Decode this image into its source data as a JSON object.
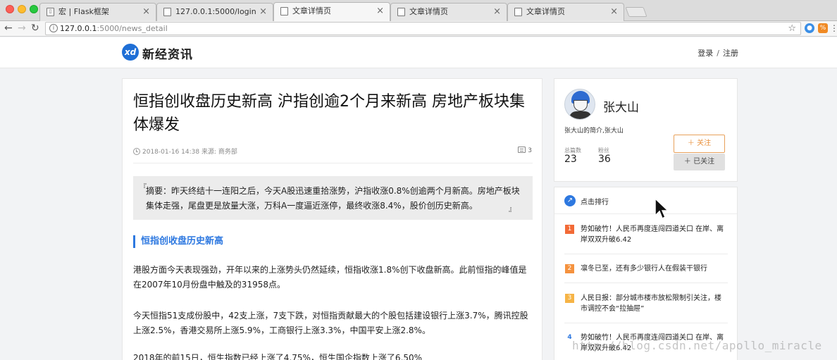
{
  "browser": {
    "tabs": [
      {
        "title": "宏 | Flask框架",
        "icon": "book-icon"
      },
      {
        "title": "127.0.0.1:5000/login",
        "icon": "page-icon"
      },
      {
        "title": "文章详情页",
        "icon": "page-icon"
      },
      {
        "title": "文章详情页",
        "icon": "page-icon"
      },
      {
        "title": "文章详情页",
        "icon": "page-icon"
      }
    ],
    "active_tab": 2,
    "url_host": "127.0.0.1",
    "url_path": ":5000/news_detail"
  },
  "site": {
    "logo_mark": "xd",
    "logo_text": "新经资讯",
    "login": "登录",
    "separator": "/",
    "register": "注册"
  },
  "article": {
    "title": "恒指创收盘历史新高 沪指创逾2个月来新高 房地产板块集体爆发",
    "datetime": "2018-01-16 14:38",
    "source": "来源: 商务部",
    "comment_count": "3",
    "summary": "摘要：昨天终结十一连阳之后，今天A股迅速重拾涨势，沪指收涨0.8%创逾两个月新高。房地产板块集体走强，尾盘更是放量大涨，万科A一度逼近涨停，最终收涨8.4%，股价创历史新高。",
    "section_heading": "恒指创收盘历史新高",
    "paragraphs": [
      "港股方面今天表现强劲，开年以来的上涨势头仍然延续，恒指收涨1.8%创下收盘新高。此前恒指的峰值是在2007年10月份盘中触及的31958点。",
      "今天恒指51支成份股中，42支上涨，7支下跌，对恒指贡献最大的个股包括建设银行上涨3.7%，腾讯控股上涨2.5%，香港交易所上涨5.9%，工商银行上涨3.3%，中国平安上涨2.8%。",
      "2018年的前15日，恒生指数已经上涨了4.75%，恒生国企指数上涨了6.50%"
    ]
  },
  "author": {
    "name": "张大山",
    "description": "张大山的简介,张大山",
    "posts_label": "总篇数",
    "posts_value": "23",
    "fans_label": "粉丝",
    "fans_value": "36",
    "follow_label": "关注",
    "followed_label": "已关注"
  },
  "ranking": {
    "title": "点击排行",
    "items": [
      {
        "num": "1",
        "text": "势如破竹！人民币再度连闯四道关口 在岸、离岸双双升破6.42",
        "color": "#f26a36"
      },
      {
        "num": "2",
        "text": "凛冬已至，还有多少银行人在假装干银行",
        "color": "#f5923e"
      },
      {
        "num": "3",
        "text": "人民日报：部分城市楼市放松限制引关注，楼市调控不会“拉抽屉”",
        "color": "#f6b446"
      },
      {
        "num": "4",
        "text": "势如破竹！人民币再度连闯四道关口 在岸、离岸双双升破6.42",
        "color": "#2d78e0"
      }
    ]
  },
  "watermark": "http://blog.csdn.net/apollo_miracle"
}
